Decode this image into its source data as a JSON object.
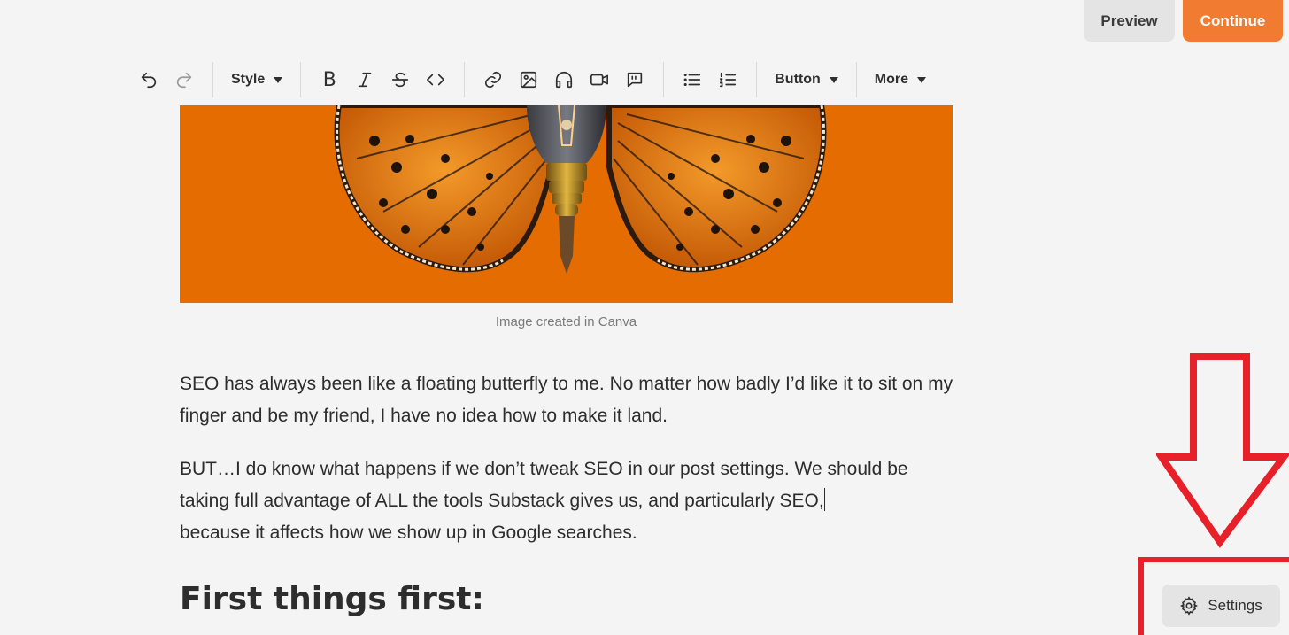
{
  "header": {
    "preview_label": "Preview",
    "continue_label": "Continue",
    "accent_color": "#f07b31"
  },
  "toolbar": {
    "style_label": "Style",
    "button_label": "Button",
    "more_label": "More",
    "icons": [
      "undo-icon",
      "redo-icon",
      "bold-icon",
      "italic-icon",
      "strikethrough-icon",
      "code-icon",
      "link-icon",
      "image-icon",
      "audio-icon",
      "video-icon",
      "quote-icon",
      "bulleted-list-icon",
      "numbered-list-icon"
    ],
    "bold_glyph": "B"
  },
  "post": {
    "image_caption": "Image created in Canva",
    "paragraphs": [
      "SEO has always been like a floating butterfly to me.  No matter how badly I’d like it to sit on my finger and be my friend, I have no idea how to make it land.",
      "BUT…I do know what happens if we don’t tweak SEO in our post settings. We should be taking full advantage of ALL the tools Substack gives us, and particularly SEO,",
      "because it affects how we show up in Google searches."
    ],
    "heading": "First things first:"
  },
  "footer": {
    "settings_label": "Settings"
  },
  "annotation": {
    "color": "#e8202a"
  }
}
